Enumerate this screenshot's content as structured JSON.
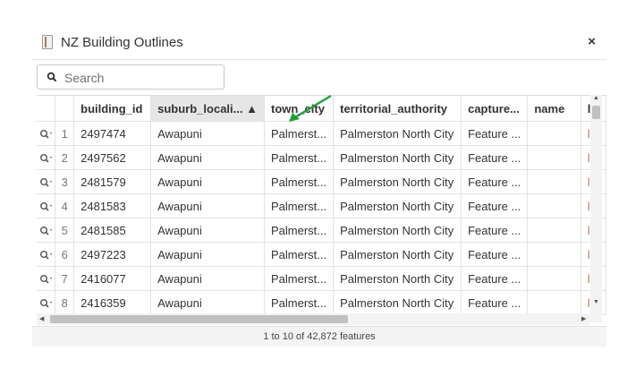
{
  "window": {
    "title": "NZ Building Outlines",
    "close_label": "×"
  },
  "search": {
    "placeholder": "Search",
    "value": ""
  },
  "table": {
    "columns": [
      "",
      "",
      "building_id",
      "suburb_locali...",
      "town_city",
      "territorial_authority",
      "capture...",
      "name",
      "l"
    ],
    "sorted_column": "suburb_locality",
    "sort_indicator": "▲",
    "rows": [
      {
        "num": "1",
        "building_id": "2497474",
        "suburb_locality": "Awapuni",
        "town_city": "Palmerst...",
        "territorial_authority": "Palmerston North City",
        "capture": "Feature ...",
        "name": "",
        "extra": "l"
      },
      {
        "num": "2",
        "building_id": "2497562",
        "suburb_locality": "Awapuni",
        "town_city": "Palmerst...",
        "territorial_authority": "Palmerston North City",
        "capture": "Feature ...",
        "name": "",
        "extra": "l"
      },
      {
        "num": "3",
        "building_id": "2481579",
        "suburb_locality": "Awapuni",
        "town_city": "Palmerst...",
        "territorial_authority": "Palmerston North City",
        "capture": "Feature ...",
        "name": "",
        "extra": "l"
      },
      {
        "num": "4",
        "building_id": "2481583",
        "suburb_locality": "Awapuni",
        "town_city": "Palmerst...",
        "territorial_authority": "Palmerston North City",
        "capture": "Feature ...",
        "name": "",
        "extra": "l"
      },
      {
        "num": "5",
        "building_id": "2481585",
        "suburb_locality": "Awapuni",
        "town_city": "Palmerst...",
        "territorial_authority": "Palmerston North City",
        "capture": "Feature ...",
        "name": "",
        "extra": "l"
      },
      {
        "num": "6",
        "building_id": "2497223",
        "suburb_locality": "Awapuni",
        "town_city": "Palmerst...",
        "territorial_authority": "Palmerston North City",
        "capture": "Feature ...",
        "name": "",
        "extra": "l"
      },
      {
        "num": "7",
        "building_id": "2416077",
        "suburb_locality": "Awapuni",
        "town_city": "Palmerst...",
        "territorial_authority": "Palmerston North City",
        "capture": "Feature ...",
        "name": "",
        "extra": "l"
      },
      {
        "num": "8",
        "building_id": "2416359",
        "suburb_locality": "Awapuni",
        "town_city": "Palmerst...",
        "territorial_authority": "Palmerston North City",
        "capture": "Feature ...",
        "name": "",
        "extra": "l"
      }
    ]
  },
  "footer": {
    "text": "1 to 10 of 42,872 features"
  },
  "icons": {
    "app": "app-icon",
    "search": "search-icon",
    "zoom": "zoom-to-feature-icon",
    "close": "close-icon"
  },
  "colors": {
    "sorted_header_bg": "#e6e6e6",
    "annotation_arrow": "#1e9e3a",
    "footer_bg": "#f4f4f4"
  }
}
